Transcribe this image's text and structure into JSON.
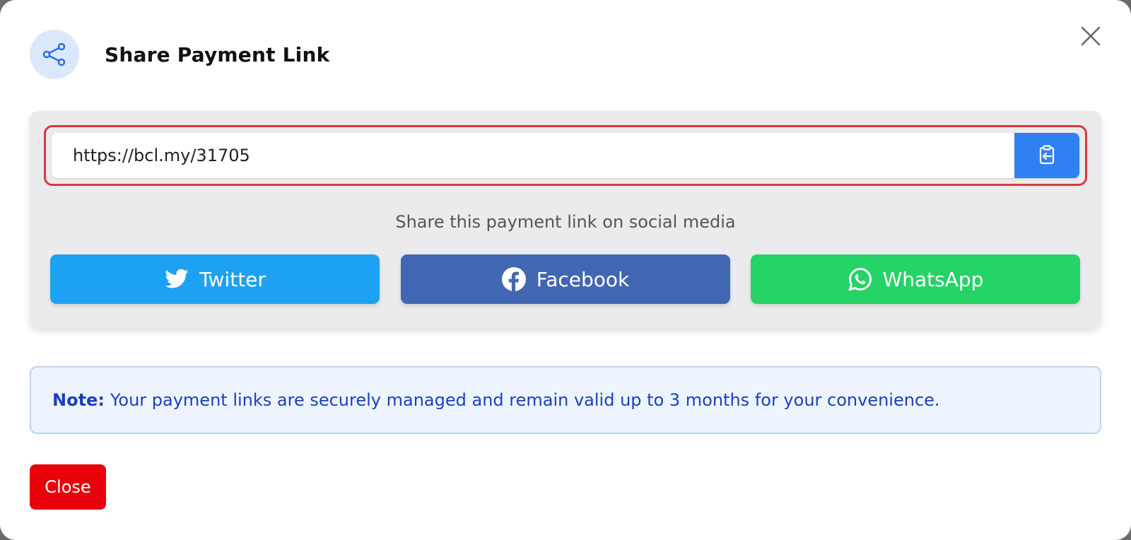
{
  "modal": {
    "title": "Share Payment Link",
    "header_icon": "share-icon",
    "close_icon": "close-icon"
  },
  "link": {
    "value": "https://bcl.my/31705",
    "copy_icon": "clipboard-icon"
  },
  "share": {
    "caption": "Share this payment link on social media",
    "buttons": [
      {
        "label": "Twitter",
        "icon": "twitter-icon",
        "color": "#1da1f2"
      },
      {
        "label": "Facebook",
        "icon": "facebook-icon",
        "color": "#4267b2"
      },
      {
        "label": "WhatsApp",
        "icon": "whatsapp-icon",
        "color": "#25d366"
      }
    ]
  },
  "note": {
    "label": "Note:",
    "text": "Your payment links are securely managed and remain valid up to 3 months for your convenience."
  },
  "footer": {
    "close_label": "Close"
  },
  "colors": {
    "accent": "#2f80f3",
    "highlight_border": "#dc3545",
    "close_button": "#e8000b",
    "note_text": "#1d3fbf"
  }
}
